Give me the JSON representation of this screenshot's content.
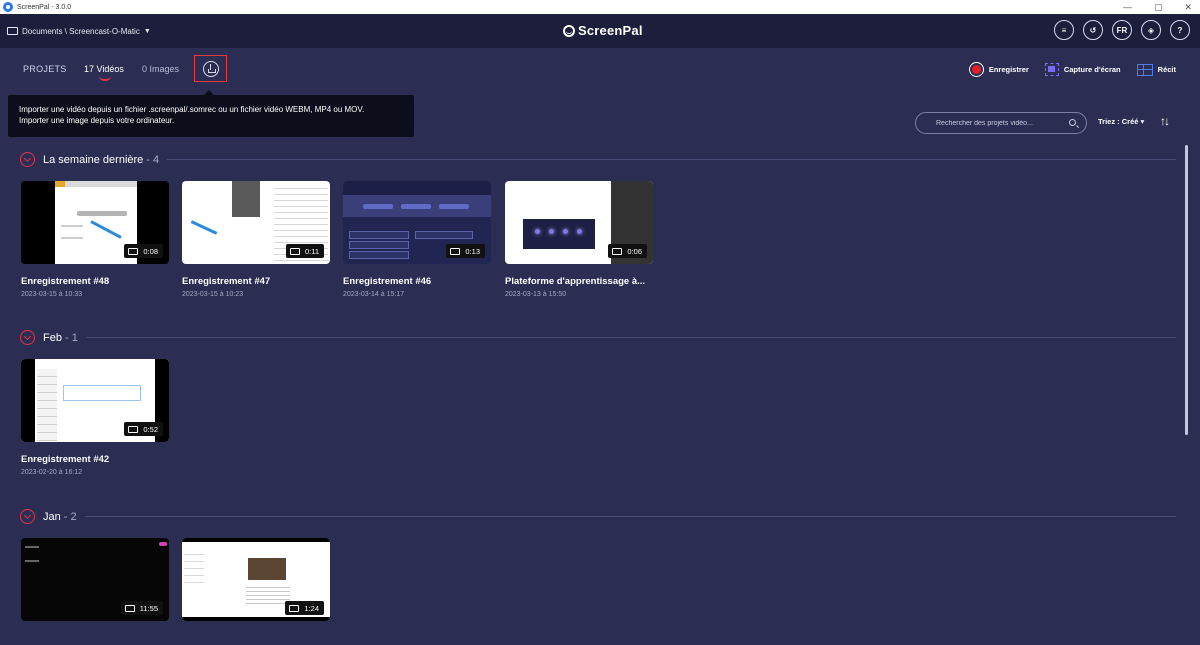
{
  "window": {
    "title": "ScreenPal - 3.0.0"
  },
  "header": {
    "breadcrumb": "Documents \\ Screencast-O-Matic",
    "brand": "ScreenPal",
    "icons": [
      {
        "name": "playlist-check-icon",
        "label": ""
      },
      {
        "name": "history-icon",
        "label": ""
      },
      {
        "name": "language-icon",
        "label": "FR"
      },
      {
        "name": "layers-icon",
        "label": ""
      },
      {
        "name": "help-icon",
        "label": "?"
      }
    ]
  },
  "toolbar": {
    "tab_projets": "PROJETS",
    "tab_videos": "17 Vidéos",
    "tab_images": "0 Images",
    "record_label": "Enregistrer",
    "capture_label": "Capture d'écran",
    "story_label": "Récit"
  },
  "tooltip": {
    "line1": "Importer une vidéo depuis un fichier .screenpal/.somrec ou un fichier vidéo WEBM, MP4 ou MOV.",
    "line2": "Importer une image depuis votre ordinateur."
  },
  "search": {
    "placeholder": "Rechercher des projets vidéo..."
  },
  "sort": {
    "label": "Triez : Créé ▾",
    "direction_icon": "sort-arrows-icon"
  },
  "sections": [
    {
      "title": "La semaine dernière",
      "count": "- 4",
      "items": [
        {
          "title": "Enregistrement #48",
          "date": "2023-03-15 à 10:33",
          "duration": "0:08"
        },
        {
          "title": "Enregistrement  #47",
          "date": "2023-03-15 à 10:23",
          "duration": "0:11"
        },
        {
          "title": "Enregistrement #46",
          "date": "2023-03-14 à 15:17",
          "duration": "0:13"
        },
        {
          "title": "Plateforme d'apprentissage à...",
          "date": "2023-03-13 à 15:50",
          "duration": "0:06"
        }
      ]
    },
    {
      "title": "Feb",
      "count": "- 1",
      "items": [
        {
          "title": "Enregistrement #42",
          "date": "2023-02-20 à 16:12",
          "duration": "0:52"
        }
      ]
    },
    {
      "title": "Jan",
      "count": "- 2",
      "items": [
        {
          "title": "",
          "date": "",
          "duration": "11:55"
        },
        {
          "title": "",
          "date": "",
          "duration": "1:24"
        }
      ]
    }
  ],
  "colors": {
    "background": "#2b2e52",
    "header": "#1c1e3c",
    "accent": "#e3344a",
    "highlight_box": "#e03a3a"
  }
}
